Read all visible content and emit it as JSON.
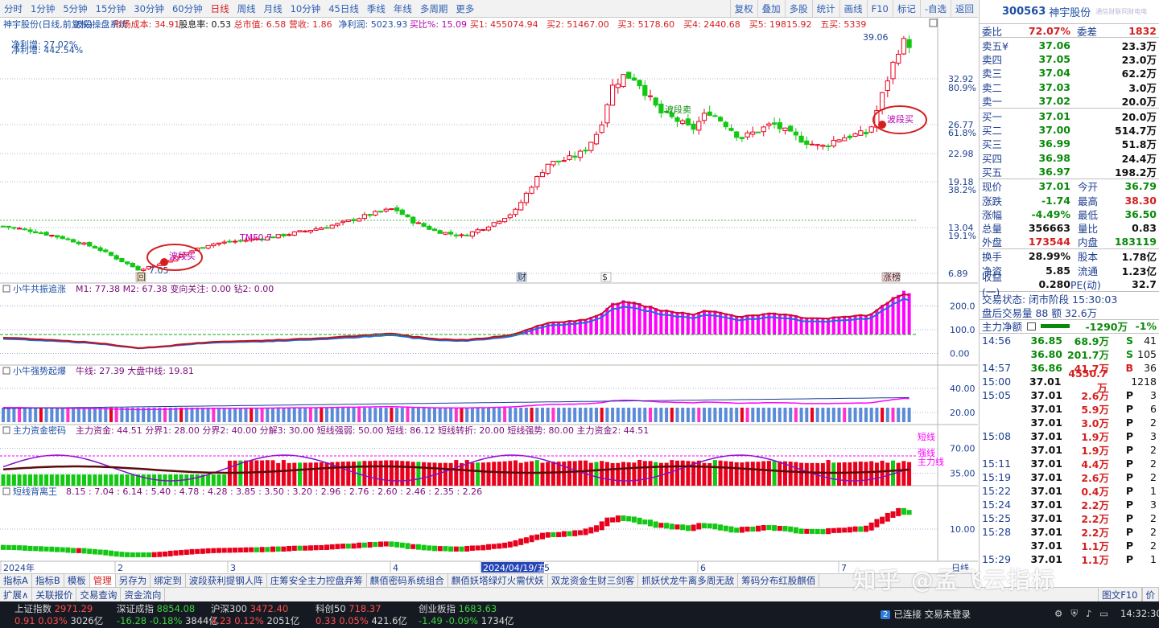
{
  "topbar": {
    "periods": [
      "分时",
      "1分钟",
      "5分钟",
      "15分钟",
      "30分钟",
      "60分钟",
      "日线",
      "周线",
      "月线",
      "10分钟",
      "45日线",
      "季线",
      "年线",
      "多周期",
      "更多"
    ],
    "active_period": "日线",
    "tools": [
      "复权",
      "叠加",
      "多股",
      "统计",
      "画线",
      "F10",
      "标记",
      "-自选",
      "返回"
    ]
  },
  "main_panel": {
    "header": [
      {
        "text": "神宇股份(日线,前复权)",
        "color": "#1d4fa3"
      },
      {
        "text": "波段操盘系统",
        "color": "#1d4fa3"
      },
      {
        "text": "市场成本: 34.91",
        "color": "#d41f1f"
      },
      {
        "text": "股息率: 0.53",
        "color": "#111111"
      },
      {
        "text": "总市值: 6.58",
        "color": "#d41f1f"
      },
      {
        "text": "营收: 1.86",
        "color": "#d41f1f"
      },
      {
        "text": "净利润: 5023.93",
        "color": "#1d4fa3"
      },
      {
        "text": "买比%: 15.09",
        "color": "#b300b3"
      },
      {
        "text": "买1: 455074.94",
        "color": "#d41f1f"
      },
      {
        "text": "买2: 51467.00",
        "color": "#d41f1f"
      },
      {
        "text": "买3: 5178.60",
        "color": "#d41f1f"
      },
      {
        "text": "买4: 2440.68",
        "color": "#d41f1f"
      },
      {
        "text": "买5: 19815.92",
        "color": "#d41f1f"
      },
      {
        "text": "五买: 5339",
        "color": "#d41f1f"
      }
    ],
    "info1": "净利增: 27.02%",
    "info2": "净利增: 442.54%",
    "peak_label": "39.06",
    "low_label": "7.05",
    "price_axis": [
      {
        "v": "32.92",
        "c": "#1d3f91"
      },
      {
        "v": "80.9%",
        "c": "#1d3f91"
      },
      {
        "v": "26.77",
        "c": "#1d3f91"
      },
      {
        "v": "61.8%",
        "c": "#1d3f91"
      },
      {
        "v": "22.98",
        "c": "#1d3f91"
      },
      {
        "v": "19.18",
        "c": "#1d3f91"
      },
      {
        "v": "38.2%",
        "c": "#1d3f91"
      },
      {
        "v": "13.04",
        "c": "#1d3f91"
      },
      {
        "v": "19.1%",
        "c": "#1d3f91"
      },
      {
        "v": "6.89",
        "c": "#1d3f91"
      }
    ],
    "signals": [
      {
        "text": "波段买",
        "color": "#b300b3"
      },
      {
        "text": "波段卖",
        "color": "#0a8a0a"
      },
      {
        "text": "波段买",
        "color": "#b300b3"
      },
      {
        "text": "TMF0.7",
        "color": "#b300b3"
      }
    ],
    "markers": [
      "回",
      "财",
      "$",
      "涨榜"
    ]
  },
  "indicators": [
    {
      "title": "小牛共振追涨",
      "params": "M1: 77.38  M2: 67.38  变向关注: 0.00  钻2: 0.00",
      "axis": [
        "200.0",
        "100.0",
        "0.00"
      ]
    },
    {
      "title": "小牛强势起爆",
      "params": "牛线: 27.39  大盘中线: 19.81",
      "axis": [
        "40.00",
        "20.00"
      ]
    },
    {
      "title": "主力资金密码",
      "params": "主力资金: 44.51  分界1: 28.00  分界2: 40.00  分解3: 30.00  短线强弱: 50.00  短线: 86.12  短线转折: 20.00  短线强势: 80.00  主力资金2: 44.51",
      "axis": [
        "70.00",
        "35.00"
      ],
      "tags": [
        "短线",
        "强线",
        "主力线"
      ]
    },
    {
      "title": "短线背离王",
      "params": "8.15 : 7.04 : 6.14 : 5.40 : 4.78 : 4.28 : 3.85 : 3.50 : 3.20 : 2.96 : 2.76 : 2.60 : 2.46 : 2.35 : 2.26",
      "axis": [
        "10.00"
      ]
    }
  ],
  "date_axis": [
    "2024年",
    "2",
    "3",
    "4",
    "2024/04/19/五",
    "5",
    "6",
    "7"
  ],
  "date_axis_right": "日线",
  "right_panel": {
    "code": "300563",
    "name": "神宇股份",
    "watermark": "通信财联同财电电",
    "wb": {
      "label": "委比",
      "value": "72.07%",
      "diff_label": "委差",
      "diff": "1832"
    },
    "sell": [
      {
        "label": "卖五¥",
        "price": "37.06",
        "vol": "23.3万"
      },
      {
        "label": "卖四",
        "price": "37.05",
        "vol": "23.0万"
      },
      {
        "label": "卖三",
        "price": "37.04",
        "vol": "62.2万"
      },
      {
        "label": "卖二",
        "price": "37.03",
        "vol": "3.0万"
      },
      {
        "label": "卖一",
        "price": "37.02",
        "vol": "20.0万"
      }
    ],
    "buy": [
      {
        "label": "买一",
        "price": "37.01",
        "vol": "20.0万"
      },
      {
        "label": "买二",
        "price": "37.00",
        "vol": "514.7万"
      },
      {
        "label": "买三",
        "price": "36.99",
        "vol": "51.8万"
      },
      {
        "label": "买四",
        "price": "36.98",
        "vol": "24.4万"
      },
      {
        "label": "买五",
        "price": "36.97",
        "vol": "198.2万"
      }
    ],
    "quote": [
      {
        "l1": "现价",
        "v1": "37.01",
        "c1": "green",
        "l2": "今开",
        "v2": "36.79",
        "c2": "green"
      },
      {
        "l1": "涨跌",
        "v1": "-1.74",
        "c1": "green",
        "l2": "最高",
        "v2": "38.30",
        "c2": "red"
      },
      {
        "l1": "涨幅",
        "v1": "-4.49%",
        "c1": "green",
        "l2": "最低",
        "v2": "36.50",
        "c2": "green"
      },
      {
        "l1": "总量",
        "v1": "356663",
        "c1": "blk",
        "l2": "量比",
        "v2": "0.83",
        "c2": "blk"
      },
      {
        "l1": "外盘",
        "v1": "173544",
        "c1": "red",
        "l2": "内盘",
        "v2": "183119",
        "c2": "green"
      }
    ],
    "quote2": [
      {
        "l1": "换手",
        "v1": "28.99%",
        "c1": "blk",
        "l2": "股本",
        "v2": "1.78亿",
        "c2": "blk"
      },
      {
        "l1": "净资",
        "v1": "5.85",
        "c1": "blk",
        "l2": "流通",
        "v2": "1.23亿",
        "c2": "blk"
      },
      {
        "l1": "收益(一)",
        "v1": "0.280",
        "c1": "blk",
        "l2": "PE(动)",
        "v2": "32.7",
        "c2": "blk"
      }
    ],
    "trade_status": "交易状态: 闭市阶段 15:30:03",
    "after_hours": "盘后交易量 88 额 32.6万",
    "main_flow": {
      "label": "主力净额",
      "value": "-1290万",
      "pct": "-1%"
    },
    "ticks": [
      {
        "t": "14:56",
        "p": "36.85",
        "vol": "68.9万",
        "bs": "S",
        "n": "41"
      },
      {
        "t": "",
        "p": "36.80",
        "vol": "201.7万",
        "bs": "S",
        "n": "105"
      },
      {
        "t": "14:57",
        "p": "36.86",
        "vol": "41.7万",
        "bs": "B",
        "n": "36"
      },
      {
        "t": "15:00",
        "p": "37.01",
        "vol": "4550.7万",
        "bs": "",
        "n": "1218"
      },
      {
        "t": "15:05",
        "p": "37.01",
        "vol": "2.6万",
        "bs": "P",
        "n": "3"
      },
      {
        "t": "",
        "p": "37.01",
        "vol": "5.9万",
        "bs": "P",
        "n": "6"
      },
      {
        "t": "",
        "p": "37.01",
        "vol": "3.0万",
        "bs": "P",
        "n": "2"
      },
      {
        "t": "15:08",
        "p": "37.01",
        "vol": "1.9万",
        "bs": "P",
        "n": "3"
      },
      {
        "t": "",
        "p": "37.01",
        "vol": "1.9万",
        "bs": "P",
        "n": "2"
      },
      {
        "t": "15:11",
        "p": "37.01",
        "vol": "4.4万",
        "bs": "P",
        "n": "2"
      },
      {
        "t": "15:19",
        "p": "37.01",
        "vol": "2.6万",
        "bs": "P",
        "n": "2"
      },
      {
        "t": "15:22",
        "p": "37.01",
        "vol": "0.4万",
        "bs": "P",
        "n": "1"
      },
      {
        "t": "15:24",
        "p": "37.01",
        "vol": "2.2万",
        "bs": "P",
        "n": "3"
      },
      {
        "t": "15:25",
        "p": "37.01",
        "vol": "2.2万",
        "bs": "P",
        "n": "2"
      },
      {
        "t": "15:28",
        "p": "37.01",
        "vol": "2.2万",
        "bs": "P",
        "n": "2"
      },
      {
        "t": "",
        "p": "37.01",
        "vol": "1.1万",
        "bs": "P",
        "n": "2"
      },
      {
        "t": "15:29",
        "p": "37.01",
        "vol": "1.1万",
        "bs": "P",
        "n": "1"
      }
    ]
  },
  "tabs1": [
    "指标A",
    "指标B",
    "模板",
    "管理",
    "另存为",
    "绑定到",
    "波段获利提钢人阵",
    "庄筹安全主力控盘弃筹",
    "麒佰密码系统组合",
    "麒佰妖塔绿灯火需伏妖",
    "双龙资金生财三剑客",
    "抓妖伏龙牛离多周无敌",
    "筹码分布红股麒佰"
  ],
  "active_tab1": "管理",
  "tabs2": [
    "扩展∧",
    "关联报价",
    "交易查询",
    "资金流向"
  ],
  "tabs2_right": [
    "图文F10",
    "价"
  ],
  "watermark_text": "知乎 @孟飞云指标",
  "statusbar": {
    "indices": [
      {
        "name": "上证指数",
        "value": "2971.29",
        "chg": "0.91",
        "pct": "0.03%",
        "amt": "3026亿",
        "up": true
      },
      {
        "name": "深证成指",
        "value": "8854.08",
        "chg": "-16.28",
        "pct": "-0.18%",
        "amt": "3844亿",
        "up": false
      },
      {
        "name": "沪深300",
        "value": "3472.40",
        "chg": "4.23",
        "pct": "0.12%",
        "amt": "2051亿",
        "up": true
      },
      {
        "name": "科创50",
        "value": "718.37",
        "chg": "0.33",
        "pct": "0.05%",
        "amt": "421.6亿",
        "up": true
      },
      {
        "name": "创业板指",
        "value": "1683.63",
        "chg": "-1.49",
        "pct": "-0.09%",
        "amt": "1734亿",
        "up": false
      }
    ],
    "conn_badge": "2",
    "conn_text": "已连接 交易未登录",
    "clock": "14:32:30"
  },
  "colors": {
    "up": "#e8001c",
    "down": "#12c812",
    "accent": "#1d4fa3",
    "magenta": "#ff00ff"
  }
}
